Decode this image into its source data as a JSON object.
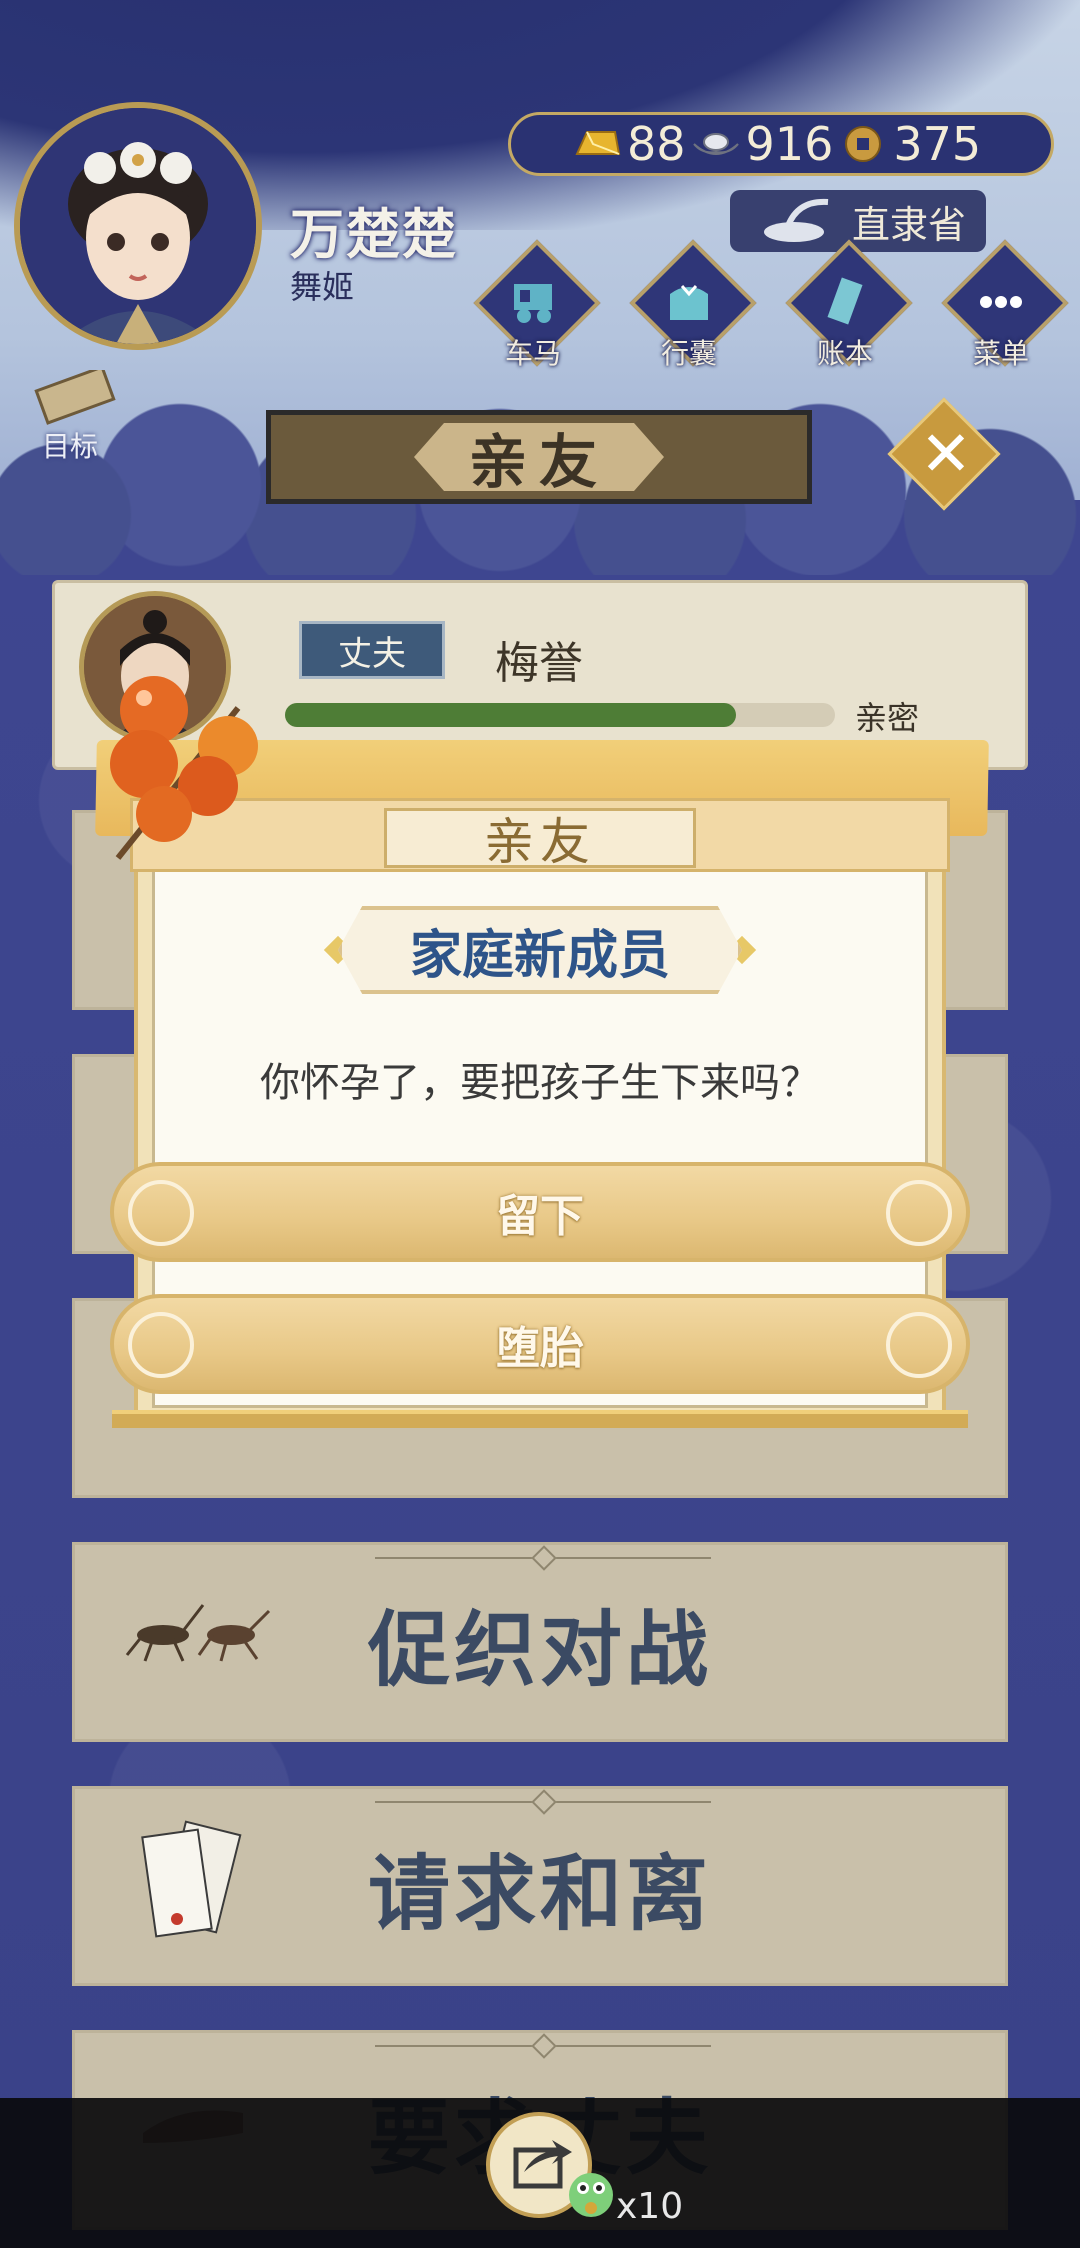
{
  "player": {
    "name": "万楚楚",
    "title": "舞姬"
  },
  "currency": [
    {
      "icon": "gold-ingot-icon",
      "value": "88"
    },
    {
      "icon": "silver-ingot-icon",
      "value": "916"
    },
    {
      "icon": "copper-coin-icon",
      "value": "375"
    }
  ],
  "region": "直隶省",
  "nav": [
    {
      "label": "车马",
      "icon": "carriage-icon"
    },
    {
      "label": "行囊",
      "icon": "bag-icon"
    },
    {
      "label": "账本",
      "icon": "ledger-icon"
    },
    {
      "label": "菜单",
      "icon": "menu-icon"
    }
  ],
  "goal": {
    "label": "目标",
    "icon": "scroll-icon"
  },
  "page_title": "亲友",
  "husband": {
    "tag": "丈夫",
    "name": "梅誉",
    "bond_label": "亲密",
    "bond_level": 0.82
  },
  "list": [
    {
      "label": "促织对战",
      "icon": "cricket-icon"
    },
    {
      "label": "请求和离",
      "icon": "divorce-letter-icon"
    },
    {
      "label": "要求丈夫",
      "icon": "hand-icon"
    }
  ],
  "modal": {
    "title": "亲友",
    "heading": "家庭新成员",
    "message": "你怀孕了，要把孩子生下来吗？",
    "buttons": [
      {
        "label": "留下"
      },
      {
        "label": "堕胎"
      }
    ]
  },
  "footer": {
    "share_icon": "share-icon",
    "count": "x10"
  },
  "colors": {
    "navy": "#3a4286",
    "gold": "#e8c887",
    "heading_blue": "#2e5489",
    "bond_green": "#4e7d36"
  }
}
